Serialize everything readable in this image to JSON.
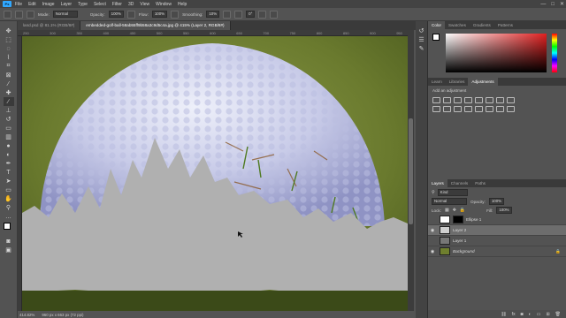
{
  "app": {
    "logo": "Ps"
  },
  "menu": [
    "File",
    "Edit",
    "Image",
    "Layer",
    "Type",
    "Select",
    "Filter",
    "3D",
    "View",
    "Window",
    "Help"
  ],
  "window_controls": {
    "min": "—",
    "max": "□",
    "close": "✕"
  },
  "options": {
    "mode_label": "Mode:",
    "mode_value": "Normal",
    "opacity_label": "Opacity:",
    "opacity_value": "100%",
    "flow_label": "Flow:",
    "flow_value": "100%",
    "smoothing_label": "Smoothing:",
    "smoothing_value": "10%",
    "angle_value": "0°"
  },
  "tabs": [
    "land.psd @ 81.1% (RGB/8#)",
    "embedded-golf-ball-58ab55ff9b58a3c9d5c4a.jpg @ 415% (Layer 2, RGB/8#)"
  ],
  "ruler_ticks": [
    "250",
    "300",
    "350",
    "400",
    "450",
    "500",
    "550",
    "600",
    "650",
    "700",
    "750",
    "800",
    "850",
    "900",
    "950"
  ],
  "status": {
    "zoom": "414.82%",
    "doc": "960 px x 663 px (72 ppi)"
  },
  "color_panel": {
    "tabs": [
      "Color",
      "Swatches",
      "Gradients",
      "Patterns"
    ]
  },
  "adjust_panel": {
    "tabs": [
      "Learn",
      "Libraries",
      "Adjustments"
    ],
    "hint": "Add an adjustment"
  },
  "layers_panel": {
    "tabs": [
      "Layers",
      "Channels",
      "Paths"
    ],
    "filter_label": "Kind",
    "blend": "Normal",
    "opacity_label": "Opacity:",
    "opacity_value": "100%",
    "lock_label": "Lock:",
    "fill_label": "Fill:",
    "fill_value": "100%",
    "layers": [
      {
        "name": "Ellipse 1",
        "visible": false
      },
      {
        "name": "Layer 2",
        "visible": true
      },
      {
        "name": "Layer 1",
        "visible": false
      },
      {
        "name": "Background",
        "visible": true
      }
    ]
  },
  "colors": {
    "accent": "#31a8ff",
    "gray_fill": "#b0b0b0",
    "grass": "#6f7f2e"
  }
}
